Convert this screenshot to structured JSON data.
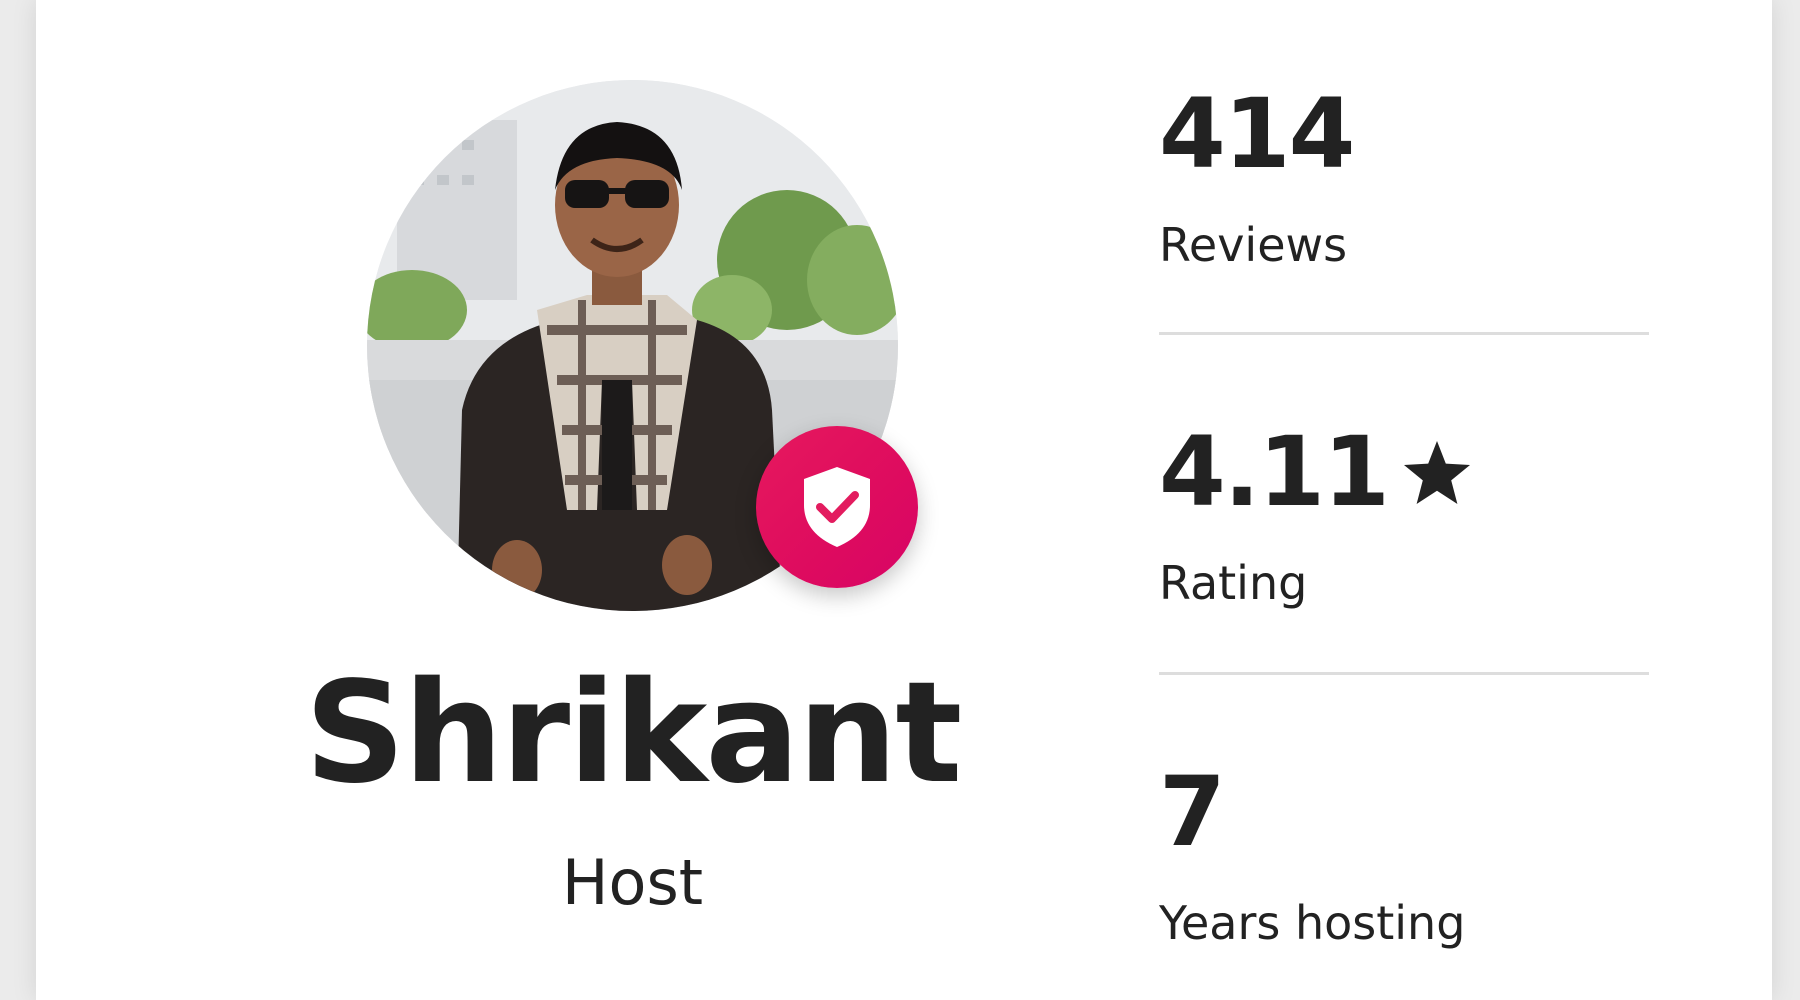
{
  "host": {
    "name": "Shrikant",
    "role": "Host",
    "verified_badge_icon": "shield-check-icon",
    "badge_color": "#E31C5F"
  },
  "stats": [
    {
      "value": "414",
      "label": "Reviews"
    },
    {
      "value": "4.11",
      "label": "Rating",
      "icon": "star-icon"
    },
    {
      "value": "7",
      "label": "Years hosting"
    }
  ]
}
